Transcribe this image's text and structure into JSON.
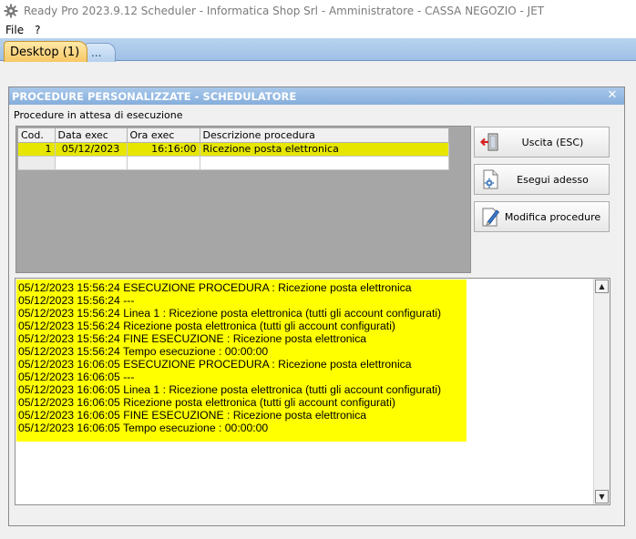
{
  "app": {
    "title": "Ready Pro 2023.9.12 Scheduler  -  Informatica Shop Srl  -  Amministratore  -  CASSA NEGOZIO  -  JET",
    "icon": "gear-icon"
  },
  "menu": [
    {
      "label": "File"
    },
    {
      "label": "?"
    }
  ],
  "tabs": [
    {
      "label": "Desktop (1)",
      "active": true
    },
    {
      "label": "...",
      "active": false
    }
  ],
  "window": {
    "title": "PROCEDURE PERSONALIZZATE - SCHEDULATORE",
    "close": "✕",
    "subtitle": "Procedure in attesa di esecuzione",
    "title_color": "#8fb4de"
  },
  "grid": {
    "columns": [
      "Cod.",
      "Data exec",
      "Ora exec",
      "Descrizione procedura"
    ],
    "rows": [
      {
        "cod": "1",
        "data": "05/12/2023",
        "ora": "16:16:00",
        "descr": "Ricezione posta elettronica",
        "selected": true
      }
    ],
    "selected_color": "#e6e600"
  },
  "buttons": {
    "exit": {
      "label": "Uscita (ESC)",
      "icon": "exit-door-icon"
    },
    "run": {
      "label": "Esegui adesso",
      "icon": "run-gear-icon"
    },
    "edit": {
      "label": "Modifica procedure",
      "icon": "edit-pencil-icon"
    }
  },
  "log": {
    "highlight_color": "#ffff00",
    "lines": [
      "05/12/2023 15:56:24 ESECUZIONE PROCEDURA : Ricezione posta elettronica",
      "05/12/2023 15:56:24 ---",
      "05/12/2023 15:56:24 Linea 1 : Ricezione posta elettronica (tutti gli account configurati)",
      "05/12/2023 15:56:24 Ricezione posta elettronica (tutti gli account configurati)",
      "05/12/2023 15:56:24 FINE ESECUZIONE : Ricezione posta elettronica",
      "05/12/2023 15:56:24 Tempo esecuzione : 00:00:00",
      "05/12/2023 16:06:05 ESECUZIONE PROCEDURA : Ricezione posta elettronica",
      "05/12/2023 16:06:05 ---",
      "05/12/2023 16:06:05 Linea 1 : Ricezione posta elettronica (tutti gli account configurati)",
      "05/12/2023 16:06:05 Ricezione posta elettronica (tutti gli account configurati)",
      "05/12/2023 16:06:05 FINE ESECUZIONE : Ricezione posta elettronica",
      "05/12/2023 16:06:05 Tempo esecuzione : 00:00:00"
    ]
  }
}
